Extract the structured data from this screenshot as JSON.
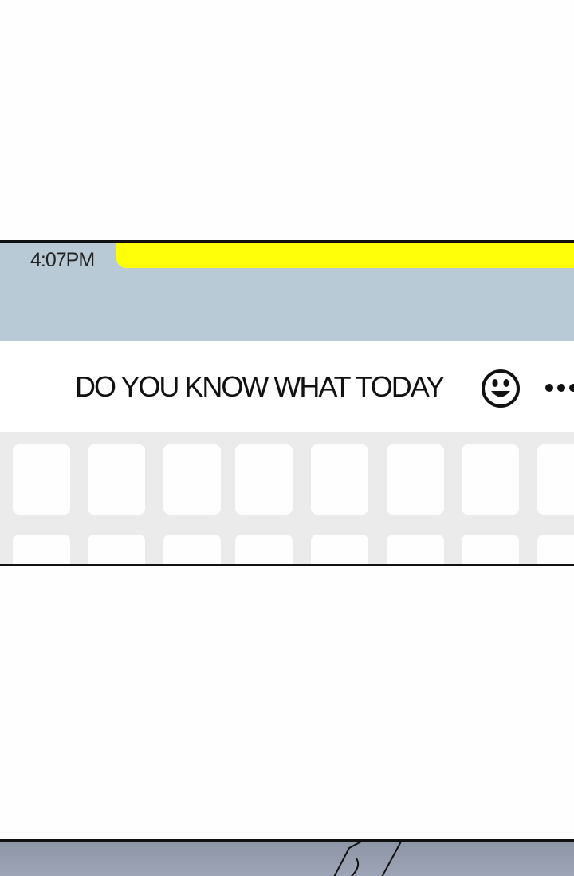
{
  "chat": {
    "timestamp": "4:07PM",
    "input_text": "DO YOU KNOW WHAT TODAY"
  },
  "icons": {
    "emoji": "smiley-face-icon",
    "more": "more-dots-icon"
  },
  "colors": {
    "message_background": "#b8cad6",
    "sent_bubble": "#ffff0a",
    "input_background": "#ffffff",
    "keyboard_background": "#ebebeb",
    "key_color": "#fefefe"
  }
}
